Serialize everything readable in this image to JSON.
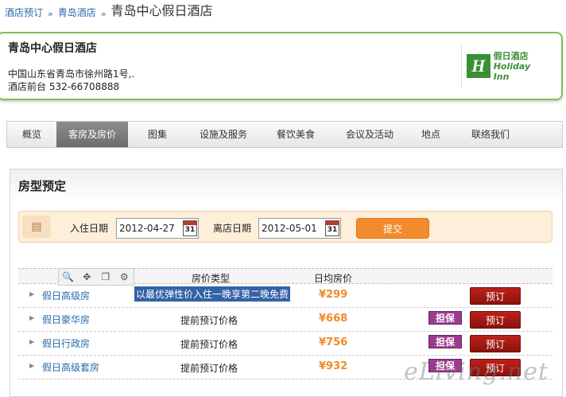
{
  "breadcrumb": {
    "items": [
      "酒店预订",
      "青岛酒店"
    ],
    "separator": "»",
    "current": "青岛中心假日酒店"
  },
  "hotel": {
    "name": "青岛中心假日酒店",
    "address": "中国山东省青岛市徐州路1号,.",
    "phone": "酒店前台  532-66708888",
    "logo_cn": "假日酒店",
    "logo_en": "Holiday Inn",
    "logo_mark": "H",
    "brand_color": "#3b8f35"
  },
  "nav": {
    "items": [
      "概览",
      "客房及房价",
      "图集",
      "设施及服务",
      "餐饮美食",
      "会议及活动",
      "地点",
      "联络我们"
    ],
    "active_index": 1
  },
  "booking": {
    "title": "房型预定",
    "checkin_label": "入住日期",
    "checkin_value": "2012-04-27",
    "checkout_label": "离店日期",
    "checkout_value": "2012-05-01",
    "calendar_day": "31",
    "submit_label": "提交"
  },
  "table": {
    "headers": {
      "price_type": "房价类型",
      "avg_price": "日均房价"
    },
    "rows": [
      {
        "room": "假日高级房",
        "price_type": "以最优弹性价入住一晚享第二晚免费",
        "price": "¥299",
        "guarantee": "",
        "book": "预订"
      },
      {
        "room": "假日豪华房",
        "price_type": "提前预订价格",
        "price": "¥668",
        "guarantee": "担保",
        "book": "预订"
      },
      {
        "room": "假日行政房",
        "price_type": "提前预订价格",
        "price": "¥756",
        "guarantee": "担保",
        "book": "预订"
      },
      {
        "room": "假日高级套房",
        "price_type": "提前预订价格",
        "price": "¥932",
        "guarantee": "担保",
        "book": "预订"
      }
    ]
  },
  "watermark": "eLiving.net"
}
